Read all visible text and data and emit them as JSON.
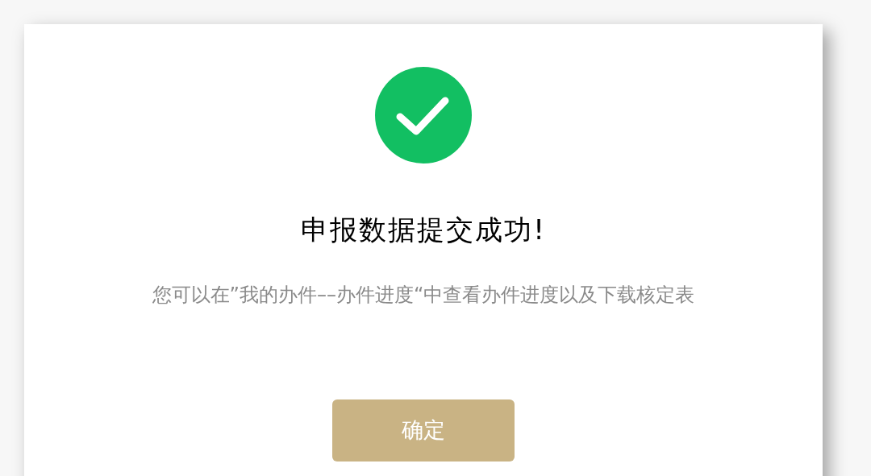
{
  "dialog": {
    "title": "申报数据提交成功!",
    "message": "您可以在”我的办件––办件进度“中查看办件进度以及下载核定表",
    "confirm_button": "确定"
  }
}
